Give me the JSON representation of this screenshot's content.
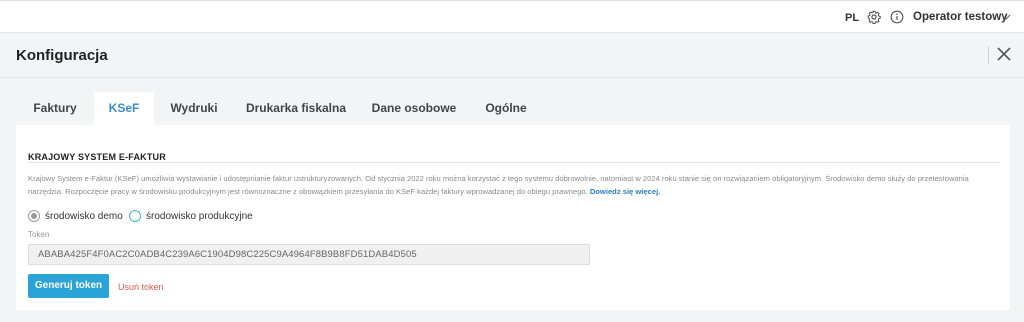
{
  "topbar": {
    "language": "PL",
    "settings_icon": "gear-icon",
    "info_icon": "info-icon",
    "user_name": "Operator testowy",
    "user_menu_icon": "chevron-down-icon"
  },
  "header": {
    "title": "Konfiguracja",
    "close_icon": "close-icon"
  },
  "tabs": [
    {
      "label": "Faktury",
      "active": false
    },
    {
      "label": "KSeF",
      "active": true
    },
    {
      "label": "Wydruki",
      "active": false
    },
    {
      "label": "Drukarka fiskalna",
      "active": false
    },
    {
      "label": "Dane osobowe",
      "active": false
    },
    {
      "label": "Ogólne",
      "active": false
    }
  ],
  "ksef": {
    "section_title": "KRAJOWY SYSTEM E-FAKTUR",
    "description": "Krajowy System e-Faktur (KSeF) umożliwia wystawianie i udostępnianie faktur ustrukturyzowanych. Od stycznia 2022 roku można korzystać z tego systemu dobrowolnie, natomiast w 2024 roku stanie się on rozwiązaniem obligatoryjnym. Środowisko demo służy do przetestowania narzędzia. Rozpoczęcie pracy w środowisku produkcyjnym jest równoznaczne z obowiązkiem przesyłania do KSeF każdej faktury wprowadzanej do obiegu prawnego.",
    "learn_more": "Dowiedz się więcej.",
    "environments": [
      {
        "label": "środowisko demo",
        "selected": true
      },
      {
        "label": "środowisko produkcyjne",
        "selected": false
      }
    ],
    "token_label": "Token",
    "token_value": "ABABA425F4F0AC2C0ADB4C239A6C1904D98C225C9A4964F8B9B8FD51DAB4D505",
    "generate_button": "Generuj token",
    "remove_link": "Usuń token"
  },
  "colors": {
    "accent": "#2aa3d6",
    "active_tab_text": "#3a8dc9",
    "danger": "#e35a4f",
    "radio_outline": "#3ab6cc"
  }
}
